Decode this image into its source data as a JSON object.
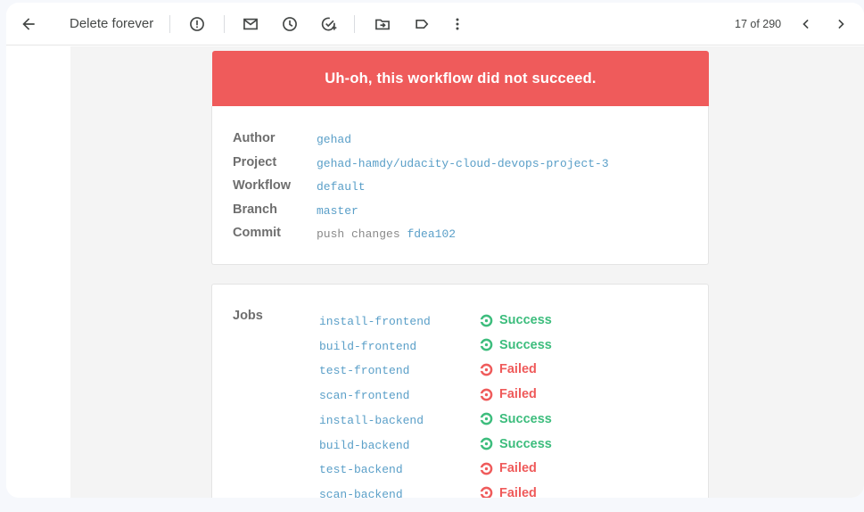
{
  "toolbar": {
    "delete_forever_label": "Delete forever",
    "counter": "17 of 290",
    "icons": [
      "back-arrow-icon",
      "report-spam-icon",
      "mark-unread-icon",
      "snooze-icon",
      "add-to-tasks-icon",
      "move-to-icon",
      "label-icon",
      "more-options-icon",
      "newer-chevron-icon",
      "older-chevron-icon"
    ]
  },
  "banner": {
    "text": "Uh-oh, this workflow did not succeed."
  },
  "details": {
    "author_label": "Author",
    "author_value": "gehad",
    "project_label": "Project",
    "project_value": "gehad-hamdy/udacity-cloud-devops-project-3",
    "workflow_label": "Workflow",
    "workflow_value": "default",
    "branch_label": "Branch",
    "branch_value": "master",
    "commit_label": "Commit",
    "commit_message": "push changes",
    "commit_hash": "fdea102"
  },
  "jobs": {
    "label": "Jobs",
    "items": [
      {
        "name": "install-frontend",
        "status": "Success"
      },
      {
        "name": "build-frontend",
        "status": "Success"
      },
      {
        "name": "test-frontend",
        "status": "Failed"
      },
      {
        "name": "scan-frontend",
        "status": "Failed"
      },
      {
        "name": "install-backend",
        "status": "Success"
      },
      {
        "name": "build-backend",
        "status": "Success"
      },
      {
        "name": "test-backend",
        "status": "Failed"
      },
      {
        "name": "scan-backend",
        "status": "Failed"
      }
    ]
  },
  "colors": {
    "banner": "#ef5b5b",
    "success": "#3dbd7d",
    "failed": "#ef5b5b",
    "link": "#5a9fc8"
  }
}
